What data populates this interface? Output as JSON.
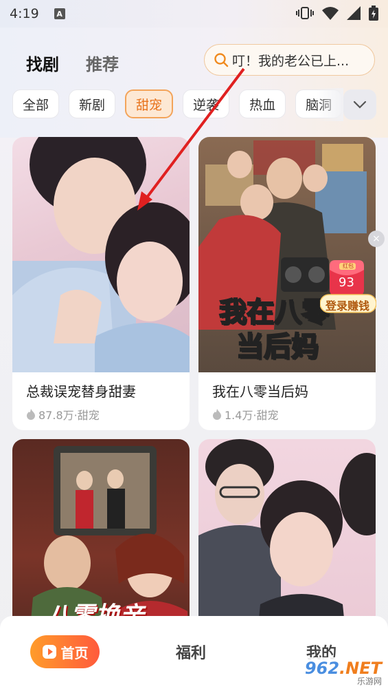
{
  "status_bar": {
    "time": "4:19",
    "notif_icon": "A"
  },
  "header": {
    "tabs": [
      "找剧",
      "推荐"
    ],
    "search_placeholder": "叮！我的老公已上..."
  },
  "categories": {
    "items": [
      "全部",
      "新剧",
      "甜宠",
      "逆袭",
      "热血",
      "脑洞"
    ],
    "selected": "甜宠"
  },
  "dramas": [
    {
      "title": "总裁误宠替身甜妻",
      "views": "87.8万",
      "genre": "甜宠",
      "meta": "87.8万·甜宠"
    },
    {
      "title": "我在八零当后妈",
      "views": "1.4万",
      "genre": "甜宠",
      "meta": "1.4万·甜宠",
      "poster_text": [
        "我在八零",
        "当后妈"
      ]
    },
    {
      "title": "",
      "views": "",
      "genre": "",
      "meta": "",
      "poster_text": [
        "八零换亲"
      ]
    },
    {
      "title": "",
      "views": "",
      "genre": "",
      "meta": ""
    }
  ],
  "reward": {
    "count": "93",
    "label": "登录赚钱",
    "tag": "红包"
  },
  "bottom_nav": [
    {
      "label": "首页",
      "active": true
    },
    {
      "label": "福利",
      "active": false
    },
    {
      "label": "我的",
      "active": false
    }
  ],
  "watermark": {
    "brand_a": "962",
    "brand_b": ".NET",
    "sub": "乐游网"
  },
  "colors": {
    "accent": "#f3a45a",
    "accent_text": "#e8731c",
    "nav_gradient_start": "#ff9c2a",
    "nav_gradient_end": "#ff5a3c",
    "arrow": "#e02020"
  }
}
